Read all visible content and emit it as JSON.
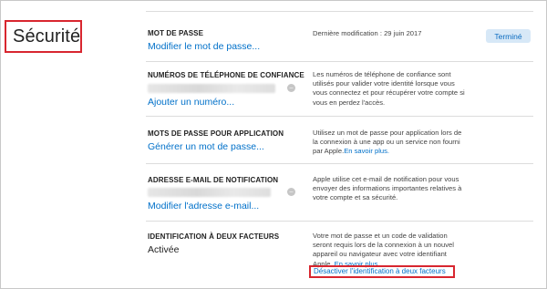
{
  "section": {
    "title": "Sécurité"
  },
  "password": {
    "label": "MOT DE PASSE",
    "link": "Modifier le mot de passe...",
    "last_modified": "Dernière modification : 29 juin 2017",
    "done_button": "Terminé"
  },
  "trusted_phones": {
    "label": "NUMÉROS DE TÉLÉPHONE DE CONFIANCE",
    "link": "Ajouter un numéro...",
    "description_lines": [
      "Les numéros de téléphone de confiance sont",
      "utilisés pour valider votre identité lorsque vous",
      "vous connectez et pour récupérer votre compte si",
      "vous en perdez l'accès."
    ]
  },
  "app_passwords": {
    "label": "MOTS DE PASSE POUR APPLICATION",
    "link": "Générer un mot de passe...",
    "description_lines": [
      "Utilisez un mot de passe pour application lors de",
      "la connexion à une app ou un service non fourni",
      "par Apple."
    ],
    "learn_more": "En savoir plus."
  },
  "notification_email": {
    "label": "ADRESSE E-MAIL DE NOTIFICATION",
    "link": "Modifier l'adresse e-mail...",
    "description_lines": [
      "Apple utilise cet e-mail de notification pour vous",
      "envoyer des informations importantes relatives à",
      "votre compte et sa sécurité."
    ]
  },
  "two_factor": {
    "label": "IDENTIFICATION À DEUX FACTEURS",
    "status": "Activée",
    "description_lines": [
      "Votre mot de passe et un code de validation",
      "seront requis lors de la connexion à un nouvel",
      "appareil ou navigateur avec votre identifiant",
      "Apple."
    ],
    "learn_more": "En savoir plus.",
    "deactivate_link": "Désactiver l'identification à deux facteurs"
  },
  "icons": {
    "remove": "remove-circle-icon"
  },
  "colors": {
    "link": "#0070c9",
    "highlight": "#d8262f",
    "button_bg": "#d7e8f7"
  }
}
